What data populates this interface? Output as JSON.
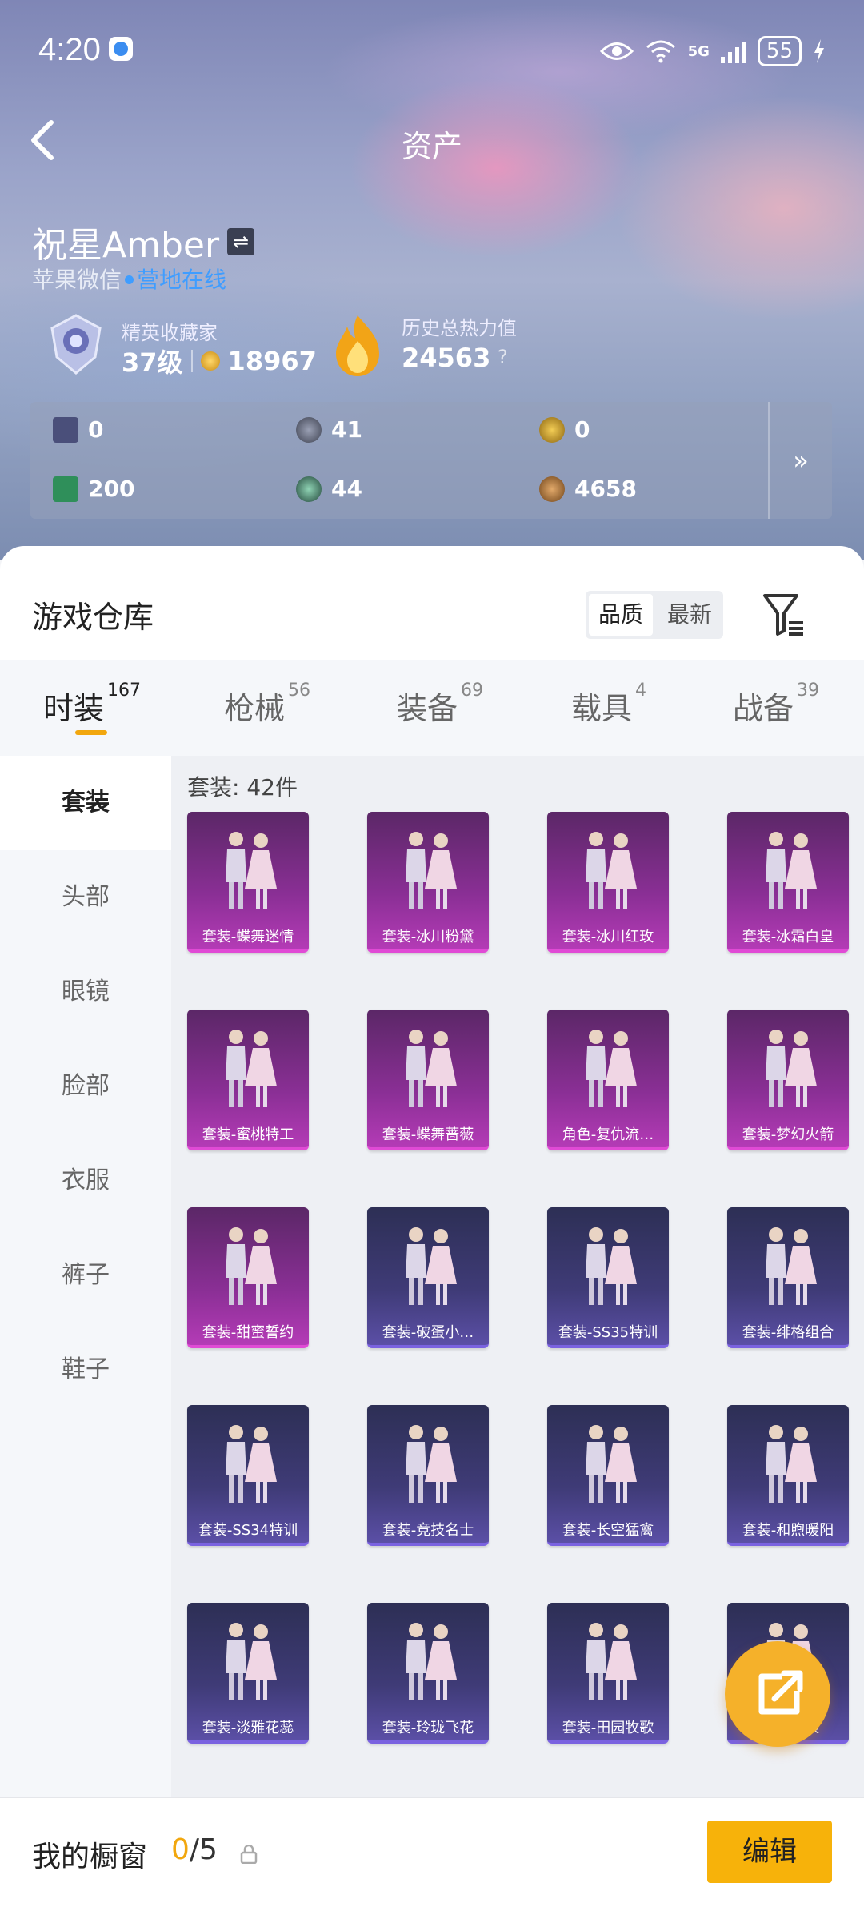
{
  "status": {
    "time": "4:20",
    "battery": "55",
    "network": "5G"
  },
  "header": {
    "title": "资产"
  },
  "profile": {
    "name": "祝星Amber",
    "platform": "苹果微信",
    "online": "营地在线",
    "badge_label": "精英收藏家",
    "level": "37级",
    "points": "18967",
    "heat_label": "历史总热力值",
    "heat_value": "24563",
    "help": "?"
  },
  "resources": [
    {
      "value": "0",
      "color": "#4a4f7a"
    },
    {
      "value": "41",
      "color": "#565b6c"
    },
    {
      "value": "0",
      "color": "#c3921c"
    },
    {
      "value": "200",
      "color": "#2f8f5a"
    },
    {
      "value": "44",
      "color": "#3b6e58"
    },
    {
      "value": "4658",
      "color": "#9b6a2f"
    }
  ],
  "resources_more": "»",
  "warehouse": {
    "title": "游戏仓库",
    "sort_options": [
      "品质",
      "最新"
    ]
  },
  "tabs": [
    {
      "label": "时装",
      "count": "167"
    },
    {
      "label": "枪械",
      "count": "56"
    },
    {
      "label": "装备",
      "count": "69"
    },
    {
      "label": "载具",
      "count": "4"
    },
    {
      "label": "战备",
      "count": "39"
    }
  ],
  "side": [
    "套装",
    "头部",
    "眼镜",
    "脸部",
    "衣服",
    "裤子",
    "鞋子"
  ],
  "count_label": "套装: 42件",
  "items": [
    {
      "name": "套装-蝶舞迷情",
      "tier": "pink"
    },
    {
      "name": "套装-冰川粉黛",
      "tier": "pink"
    },
    {
      "name": "套装-冰川红玫",
      "tier": "pink"
    },
    {
      "name": "套装-冰霜白皇",
      "tier": "pink"
    },
    {
      "name": "套装-蜜桃特工",
      "tier": "pink"
    },
    {
      "name": "套装-蝶舞蔷薇",
      "tier": "pink"
    },
    {
      "name": "角色-复仇流…",
      "tier": "pink"
    },
    {
      "name": "套装-梦幻火箭",
      "tier": "pink"
    },
    {
      "name": "套装-甜蜜誓约",
      "tier": "pink"
    },
    {
      "name": "套装-破蛋小…",
      "tier": "purple"
    },
    {
      "name": "套装-SS35特训",
      "tier": "purple"
    },
    {
      "name": "套装-绯格组合",
      "tier": "purple"
    },
    {
      "name": "套装-SS34特训",
      "tier": "purple"
    },
    {
      "name": "套装-竞技名士",
      "tier": "purple"
    },
    {
      "name": "套装-长空猛禽",
      "tier": "purple"
    },
    {
      "name": "套装-和煦暖阳",
      "tier": "purple"
    },
    {
      "name": "套装-淡雅花蕊",
      "tier": "purple"
    },
    {
      "name": "套装-玲珑飞花",
      "tier": "purple"
    },
    {
      "name": "套装-田园牧歌",
      "tier": "purple"
    },
    {
      "name": "套装-白浪",
      "tier": "purple"
    }
  ],
  "footer": {
    "label": "我的橱窗",
    "current": "0",
    "total": "/5",
    "edit": "编辑"
  }
}
